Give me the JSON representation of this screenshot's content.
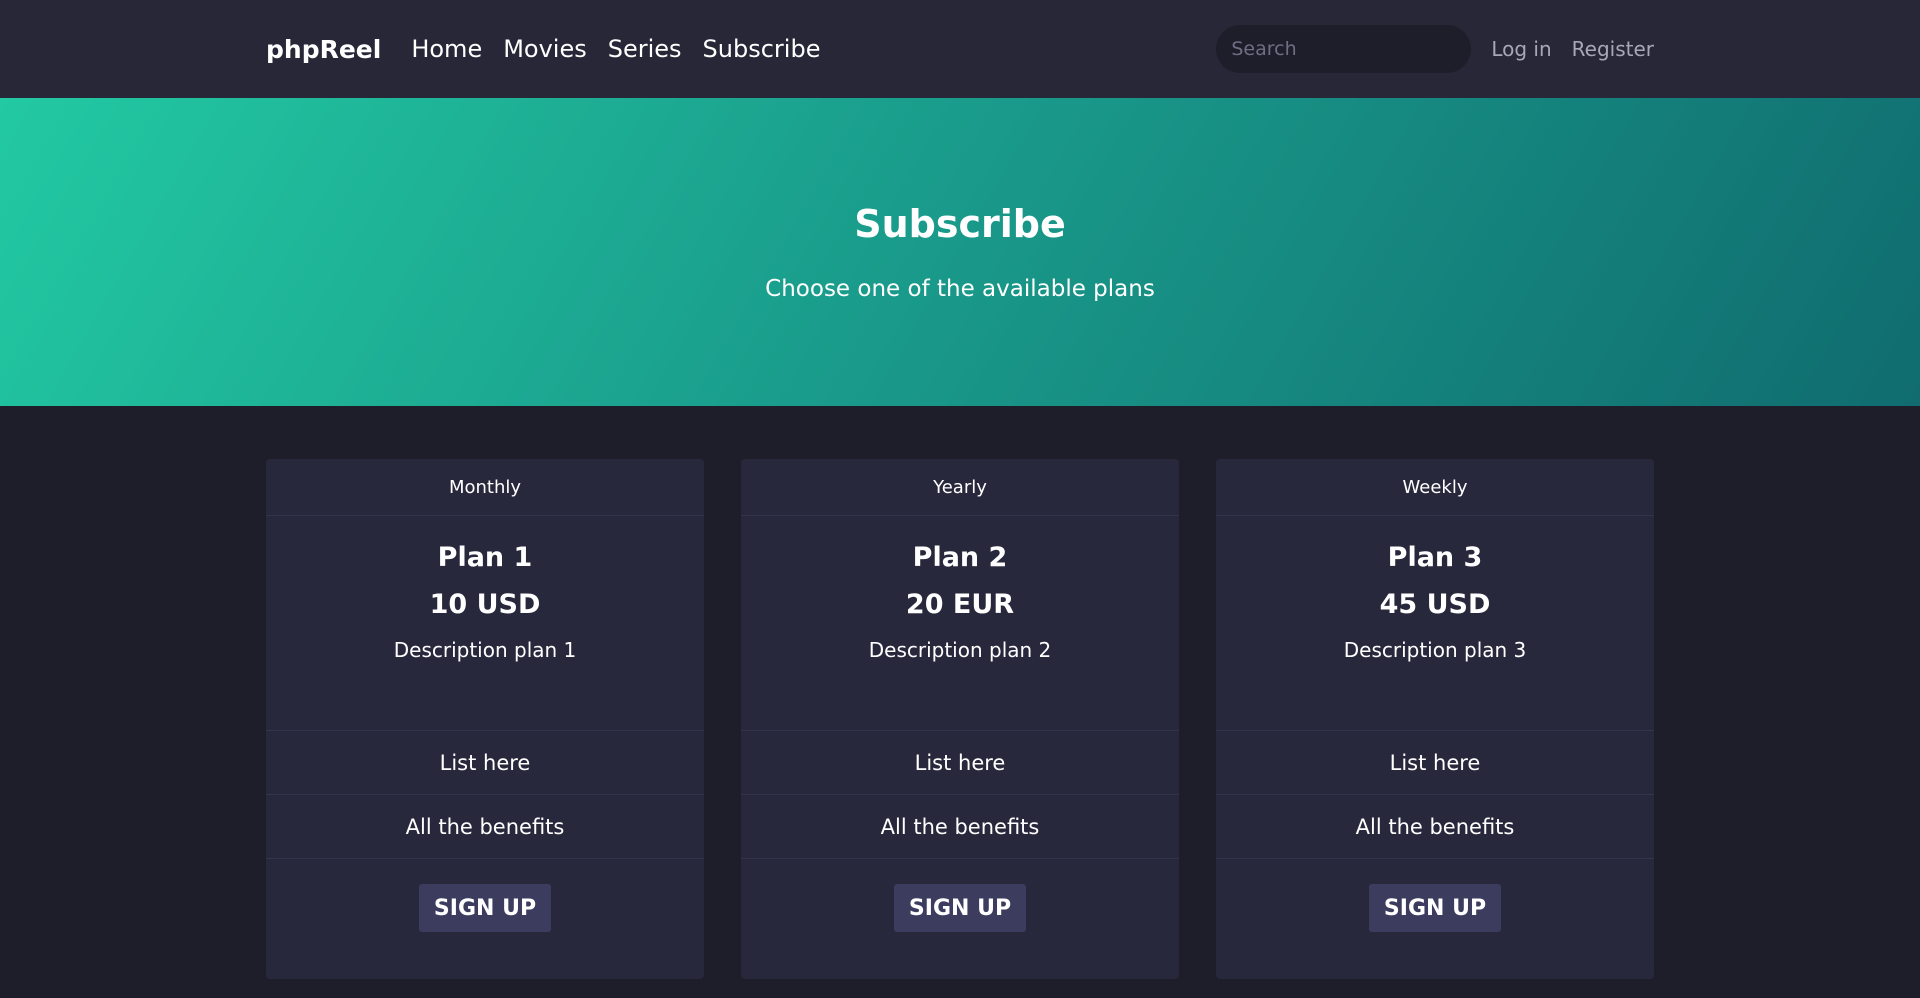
{
  "nav": {
    "brand": "phpReel",
    "links": [
      "Home",
      "Movies",
      "Series",
      "Subscribe"
    ],
    "search_placeholder": "Search",
    "login": "Log in",
    "register": "Register"
  },
  "hero": {
    "title": "Subscribe",
    "subtitle": "Choose one of the available plans"
  },
  "plans": [
    {
      "period": "Monthly",
      "name": "Plan 1",
      "price": "10 USD",
      "description": "Description plan 1",
      "benefits": [
        "List here",
        "All the benefits"
      ],
      "button": "SIGN UP"
    },
    {
      "period": "Yearly",
      "name": "Plan 2",
      "price": "20 EUR",
      "description": "Description plan 2",
      "benefits": [
        "List here",
        "All the benefits"
      ],
      "button": "SIGN UP"
    },
    {
      "period": "Weekly",
      "name": "Plan 3",
      "price": "45 USD",
      "description": "Description plan 3",
      "benefits": [
        "List here",
        "All the benefits"
      ],
      "button": "SIGN UP"
    }
  ]
}
